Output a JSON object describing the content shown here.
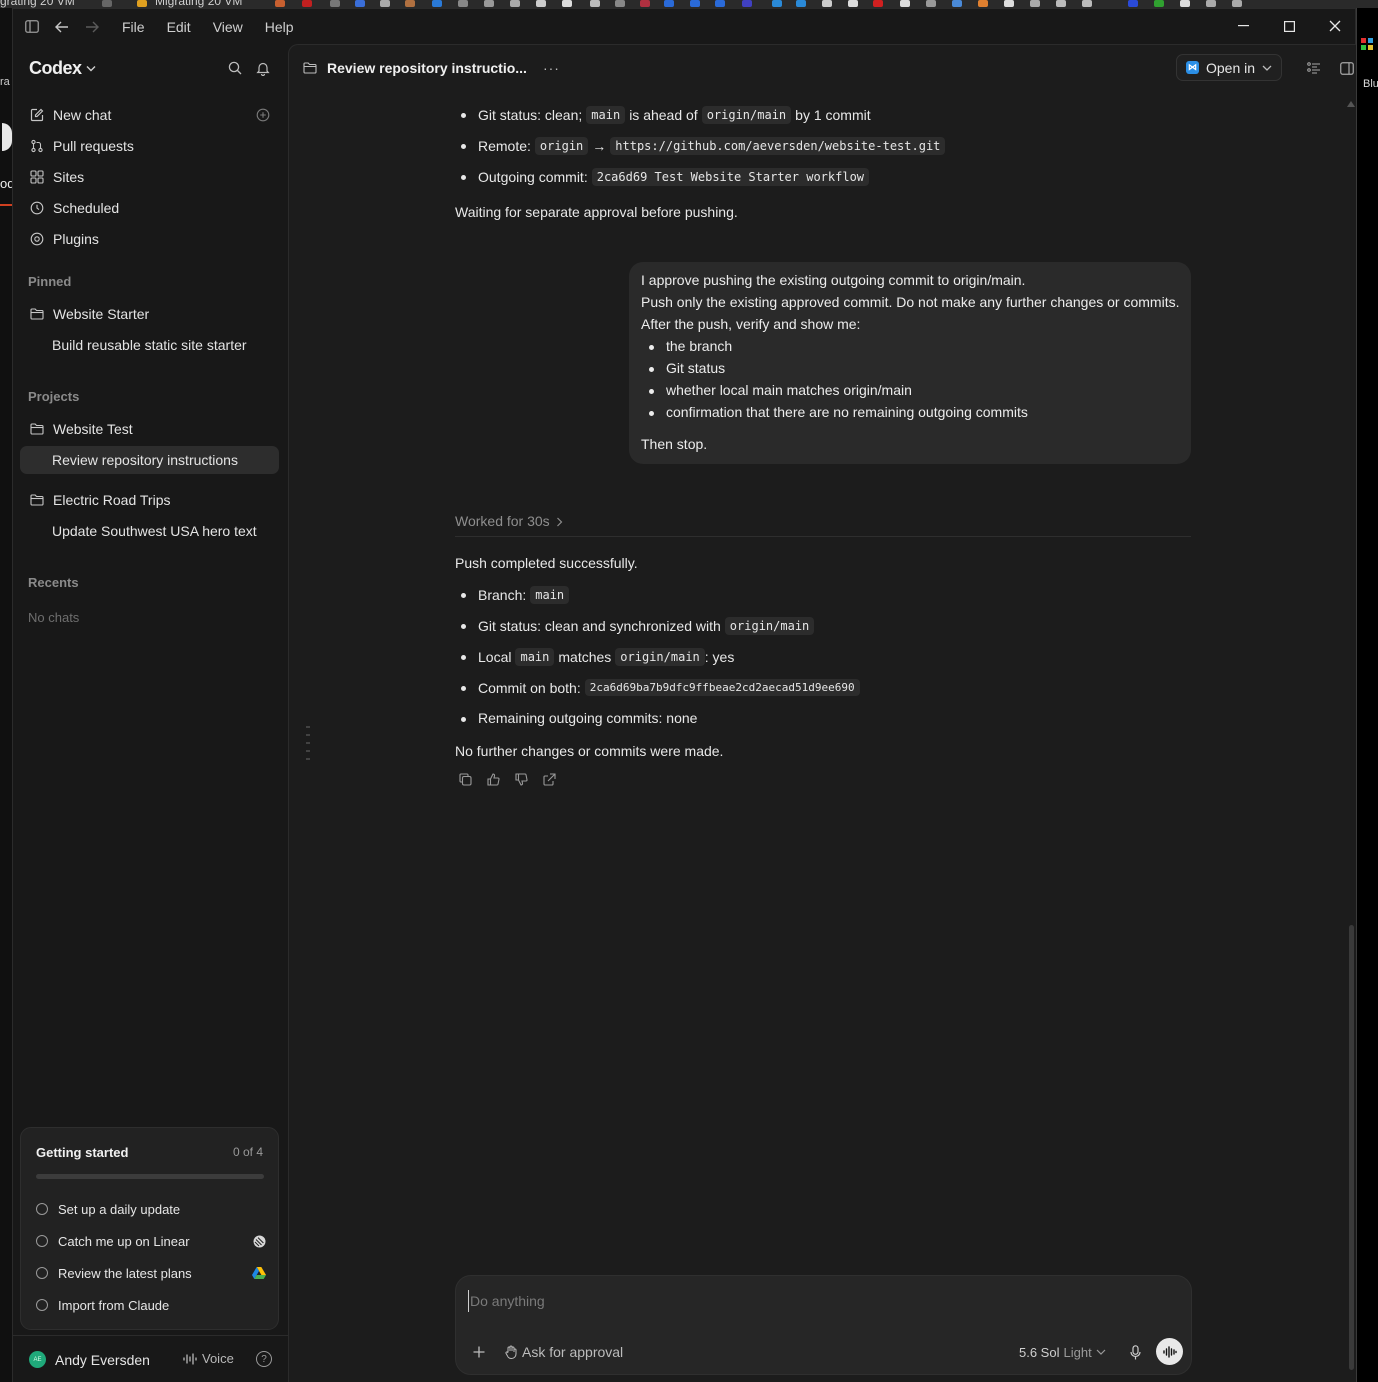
{
  "browser_tabs": {
    "left_tab": "grating 20 VM",
    "second_tab": "Migrating 20 VM",
    "right_text": "Blu"
  },
  "background_left": {
    "fragment_1": "ra",
    "fragment_2": "od"
  },
  "titlebar": {
    "menu": [
      "File",
      "Edit",
      "View",
      "Help"
    ]
  },
  "sidebar": {
    "app_name": "Codex",
    "nav": [
      {
        "label": "New chat",
        "icon": "edit-icon"
      },
      {
        "label": "Pull requests",
        "icon": "pull-request-icon"
      },
      {
        "label": "Sites",
        "icon": "sites-icon"
      },
      {
        "label": "Scheduled",
        "icon": "clock-icon"
      },
      {
        "label": "Plugins",
        "icon": "plugin-icon"
      }
    ],
    "pinned_label": "Pinned",
    "pinned": {
      "folder": "Website Starter",
      "chat": "Build reusable static site starter"
    },
    "projects_label": "Projects",
    "projects": [
      {
        "folder": "Website Test",
        "chat": "Review repository instructions"
      },
      {
        "folder": "Electric Road Trips",
        "chat": "Update Southwest USA hero text"
      }
    ],
    "recents_label": "Recents",
    "recents_empty": "No chats",
    "getting_started": {
      "title": "Getting started",
      "count": "0 of 4",
      "progress": 0,
      "items": [
        "Set up a daily update",
        "Catch me up on Linear",
        "Review the latest plans",
        "Import from Claude"
      ]
    },
    "user": {
      "name": "Andy Eversden",
      "initials": "AE",
      "voice_label": "Voice",
      "help": "?"
    }
  },
  "header": {
    "title": "Review repository instructio...",
    "more": "···",
    "open_in": "Open in"
  },
  "thread": {
    "top_bullets": {
      "b1_pre": "Git status: clean;",
      "b1_code1": "main",
      "b1_mid": "is ahead of",
      "b1_code2": "origin/main",
      "b1_post": "by 1 commit",
      "b2_pre": "Remote:",
      "b2_code1": "origin",
      "b2_arrow": "→",
      "b2_code2": "https://github.com/aeversden/website-test.git",
      "b3_pre": "Outgoing commit:",
      "b3_code": "2ca6d69 Test Website Starter workflow"
    },
    "waiting": "Waiting for separate approval before pushing.",
    "user_message": {
      "line1": "I approve pushing the existing outgoing commit to origin/main.",
      "line2": "Push only the existing approved commit. Do not make any further changes or commits.",
      "line3": "After the push, verify and show me:",
      "bullets": [
        "the branch",
        "Git status",
        "whether local main matches origin/main",
        "confirmation that there are no remaining outgoing commits"
      ],
      "closing": "Then stop."
    },
    "worked_for": "Worked for 30s",
    "result": {
      "heading": "Push completed successfully.",
      "branch_label": "Branch:",
      "branch_code": "main",
      "status_label": "Git status: clean and synchronized with",
      "status_code": "origin/main",
      "local_label": "Local",
      "local_code1": "main",
      "local_mid": "matches",
      "local_code2": "origin/main",
      "local_post": ": yes",
      "commit_label": "Commit on both:",
      "commit_code": "2ca6d69ba7b9dfc9ffbeae2cd2aecad51d9ee690",
      "remaining": "Remaining outgoing commits: none",
      "footer": "No further changes or commits were made."
    }
  },
  "composer": {
    "placeholder": "Do anything",
    "approval": "Ask for approval",
    "model": "5.6 Sol",
    "model_variant": "Light"
  }
}
